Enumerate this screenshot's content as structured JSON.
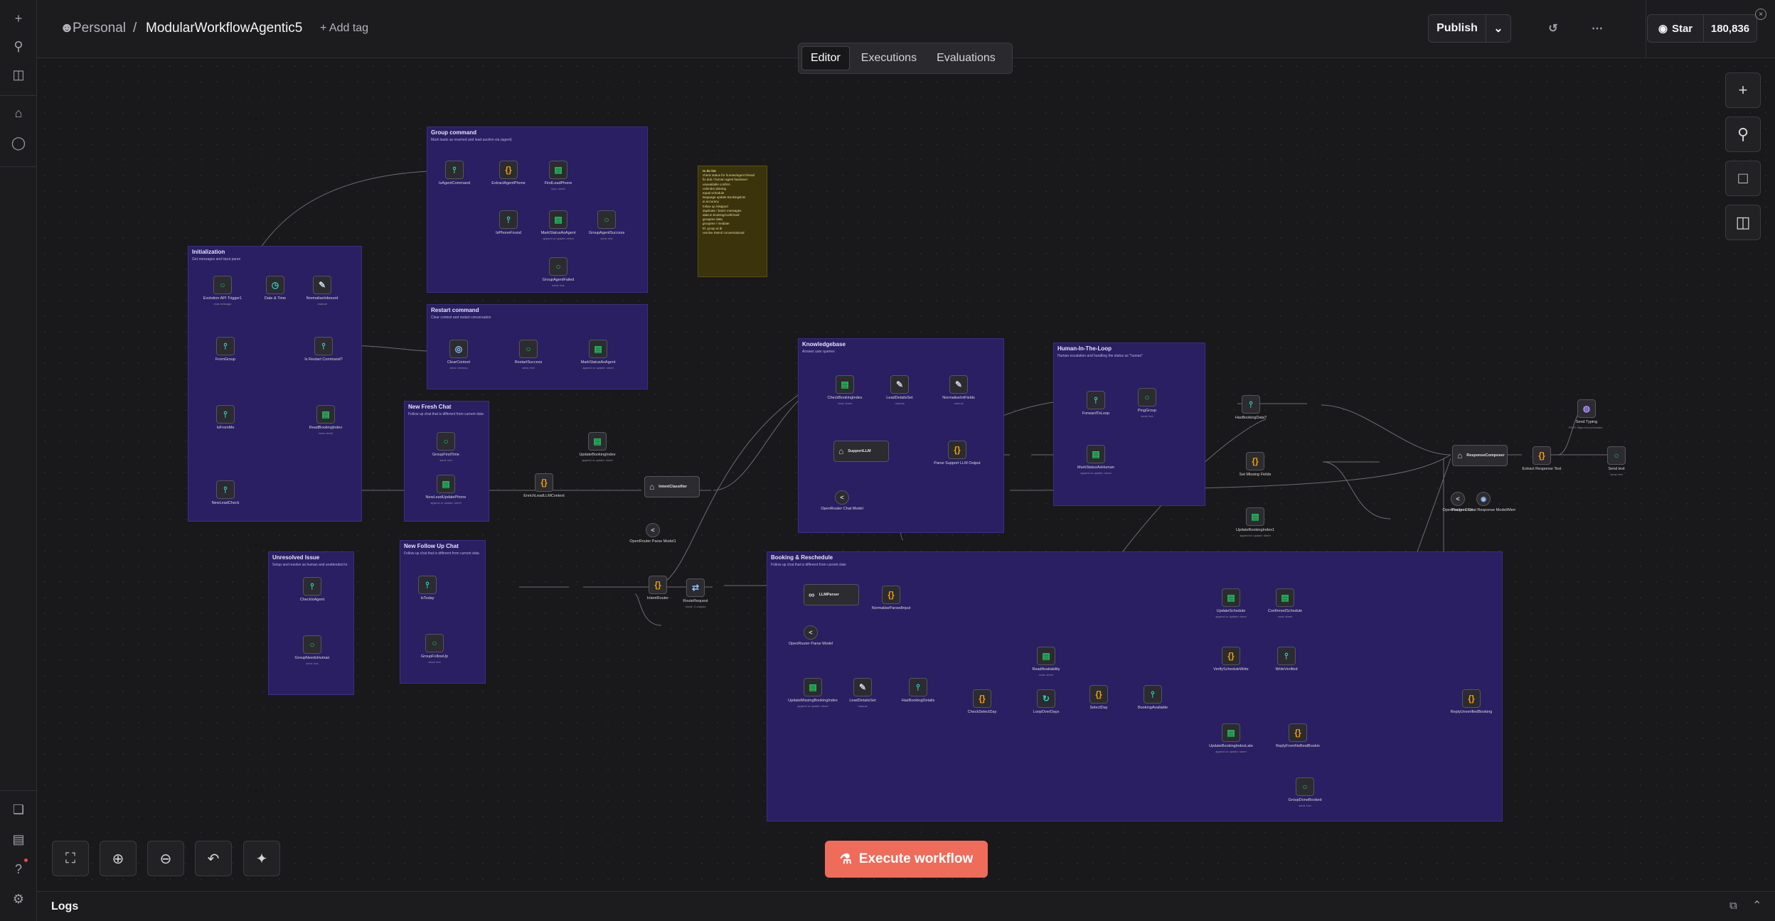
{
  "sidebar": {
    "top_icons": [
      "plus-icon",
      "search-icon",
      "panel-icon"
    ],
    "nav_icons": [
      "home-icon",
      "chat-icon"
    ],
    "bottom_icons": [
      "cube-icon",
      "chart-icon",
      "help-icon",
      "settings-icon"
    ]
  },
  "header": {
    "breadcrumb_owner": "Personal",
    "breadcrumb_sep": "/",
    "workflow_name": "ModularWorkflowAgentic5",
    "add_tag": "+ Add tag",
    "publish_label": "Publish",
    "star_label": "Star",
    "star_count": "180,836"
  },
  "tabs": [
    {
      "label": "Editor",
      "active": true
    },
    {
      "label": "Executions",
      "active": false
    },
    {
      "label": "Evaluations",
      "active": false
    }
  ],
  "execute_label": "Execute workflow",
  "logs_label": "Logs",
  "stickies": [
    {
      "title": "Initialization",
      "sub": "Get messages and input parse"
    },
    {
      "title": "Group command",
      "sub": "Mark leads as reached and lead auction via (agent)"
    },
    {
      "title": "Restart command",
      "sub": "Clear context and restart conversation"
    },
    {
      "title": "New Fresh Chat",
      "sub": "Follow up chat that is different from current data"
    },
    {
      "title": "Unresolved Issue",
      "sub": "Setup and resolve as human and unattended to"
    },
    {
      "title": "New Follow Up Chat",
      "sub": "Follow up chat that is different from current data"
    },
    {
      "title": "Knowledgebase",
      "sub": "Answer user queries"
    },
    {
      "title": "Human-In-The-Loop",
      "sub": "Human escalation and handling the status as \"human\""
    },
    {
      "title": "Booking & Reschedule",
      "sub": "Follow up chat that is different from current date"
    }
  ],
  "todo_note": {
    "title": "to do list",
    "items": [
      "check status for human/agent thread",
      "fix dob / human agent handover",
      "unavailable confirm",
      "calendar planing",
      "equal schedule",
      "language update Bookingslots",
      "ai accuracy",
      "follow up /skipped",
      "duplicate / batch messages",
      "data in booking/confirmed",
      "groupme data",
      "groupme / mediate",
      "bf. group ai tb",
      "resolve Intent/ conversational"
    ]
  },
  "nodes": [
    {
      "label": "Evolution API Trigger1",
      "sub": "chat.message",
      "icon": "chat-icon"
    },
    {
      "label": "Date & Time",
      "sub": "",
      "icon": "clock-icon"
    },
    {
      "label": "NormaliseInbound",
      "sub": "manual",
      "icon": "pen-icon"
    },
    {
      "label": "FromGroup",
      "sub": "",
      "icon": "filter-icon"
    },
    {
      "label": "Is Restart Command?",
      "sub": "",
      "icon": "filter-icon"
    },
    {
      "label": "IsFromMe",
      "sub": "",
      "icon": "filter-icon"
    },
    {
      "label": "ReadBookingIndex",
      "sub": "read: sheet",
      "icon": "sheet-icon"
    },
    {
      "label": "NewLeadCheck",
      "sub": "",
      "icon": "filter-icon"
    },
    {
      "label": "IsAgentCommand",
      "sub": "",
      "icon": "filter-icon"
    },
    {
      "label": "ExtractAgentPhone",
      "sub": "",
      "icon": "code-icon"
    },
    {
      "label": "FindLeadPhone",
      "sub": "lkup: sheet",
      "icon": "sheet-icon"
    },
    {
      "label": "IsPhoneFound",
      "sub": "",
      "icon": "filter-icon"
    },
    {
      "label": "MarkStatusAsAgent",
      "sub": "append or update: sheet",
      "icon": "sheet-icon"
    },
    {
      "label": "GroupAgentSuccess",
      "sub": "send: text",
      "icon": "chat-icon"
    },
    {
      "label": "GroupAgentFailed",
      "sub": "send: text",
      "icon": "chat-icon"
    },
    {
      "label": "ClearContext",
      "sub": "clear: memory",
      "icon": "memory-icon"
    },
    {
      "label": "RestartSuccess",
      "sub": "send: text",
      "icon": "chat-icon"
    },
    {
      "label": "MarkStatusAsAgent",
      "sub": "append or update: sheet",
      "icon": "sheet-icon"
    },
    {
      "label": "GroupFirstTime",
      "sub": "send: text",
      "icon": "chat-icon"
    },
    {
      "label": "NewLeadUpdatePhone",
      "sub": "append or update: sheet",
      "icon": "sheet-icon"
    },
    {
      "label": "EnrichLeadLLMContext",
      "sub": "",
      "icon": "code-icon"
    },
    {
      "label": "UpdateBookingIndex",
      "sub": "append or update: sheet",
      "icon": "sheet-icon"
    },
    {
      "label": "CheckIsAgent",
      "sub": "",
      "icon": "filter-icon"
    },
    {
      "label": "GroupNeedsHuman",
      "sub": "send: text",
      "icon": "chat-icon"
    },
    {
      "label": "IsToday",
      "sub": "",
      "icon": "filter-icon"
    },
    {
      "label": "GroupFollowUp",
      "sub": "send: text",
      "icon": "chat-icon"
    },
    {
      "label": "OpenRouter Parse Model1",
      "sub": "",
      "icon": "router-icon"
    },
    {
      "label": "IntentRouter",
      "sub": "",
      "icon": "code-icon"
    },
    {
      "label": "RouteRequest",
      "sub": "mode: 3 outputs",
      "icon": "switch-icon"
    },
    {
      "label": "CheckBookingIndex",
      "sub": "read: sheet",
      "icon": "sheet-icon"
    },
    {
      "label": "LeadDetailsSet",
      "sub": "manual",
      "icon": "pen-icon"
    },
    {
      "label": "NormaliseIntFields",
      "sub": "manual",
      "icon": "pen-icon"
    },
    {
      "label": "Parse Support LLM Output",
      "sub": "",
      "icon": "code-icon"
    },
    {
      "label": "OpenRouter Chat Model",
      "sub": "",
      "icon": "router-icon"
    },
    {
      "label": "ForwardToLoop",
      "sub": "",
      "icon": "filter-icon"
    },
    {
      "label": "PingGroup",
      "sub": "send: text",
      "icon": "chat-icon"
    },
    {
      "label": "MarkStatusAsHuman",
      "sub": "append or update: sheet",
      "icon": "sheet-icon"
    },
    {
      "label": "HasBookingData?",
      "sub": "",
      "icon": "filter-icon"
    },
    {
      "label": "Set Missing Fields",
      "sub": "",
      "icon": "code-icon"
    },
    {
      "label": "UpdateBookingIndex1",
      "sub": "append or update: sheet",
      "icon": "sheet-icon"
    },
    {
      "label": "Extract Response Text",
      "sub": "",
      "icon": "code-icon"
    },
    {
      "label": "Send Typing",
      "sub": "POST https://evo.evolution...",
      "icon": "globe-icon"
    },
    {
      "label": "Send text",
      "sub": "send: text",
      "icon": "chat-icon"
    },
    {
      "label": "OpenRouter Chat",
      "sub": "",
      "icon": "router-icon"
    },
    {
      "label": "Postgres Chat Response Model/Memory1",
      "sub": "",
      "icon": "db-icon"
    },
    {
      "label": "NormaliseParsedInput",
      "sub": "",
      "icon": "code-icon"
    },
    {
      "label": "OpenRouter Parse Model",
      "sub": "",
      "icon": "router-icon"
    },
    {
      "label": "UpdateMissingBookingIndex",
      "sub": "append or update: sheet",
      "icon": "sheet-icon"
    },
    {
      "label": "LeadDetailsSet",
      "sub": "manual",
      "icon": "pen-icon"
    },
    {
      "label": "HasBookingDetails",
      "sub": "",
      "icon": "filter-icon"
    },
    {
      "label": "CheckSelectDay",
      "sub": "",
      "icon": "code-icon"
    },
    {
      "label": "ReadAvailability",
      "sub": "read: sheet",
      "icon": "sheet-icon"
    },
    {
      "label": "LoopOverDays",
      "sub": "",
      "icon": "loop-icon"
    },
    {
      "label": "SelectDay",
      "sub": "",
      "icon": "code-icon"
    },
    {
      "label": "BookingAvailable",
      "sub": "",
      "icon": "filter-icon"
    },
    {
      "label": "UpdateSchedule",
      "sub": "append or update: sheet",
      "icon": "sheet-icon"
    },
    {
      "label": "ConfirmedSchedule",
      "sub": "read: sheet",
      "icon": "sheet-icon"
    },
    {
      "label": "VerifyScheduleWrite",
      "sub": "",
      "icon": "code-icon"
    },
    {
      "label": "WriteVerified",
      "sub": "",
      "icon": "filter-icon"
    },
    {
      "label": "UpdateBookingIndexLate",
      "sub": "append or update: sheet",
      "icon": "sheet-icon"
    },
    {
      "label": "ReplyFromNoBestBookin",
      "sub": "",
      "icon": "code-icon"
    },
    {
      "label": "GroupDoneBooked",
      "sub": "send: text",
      "icon": "chat-icon"
    },
    {
      "label": "ReplyUnverifiedBooking",
      "sub": "",
      "icon": "code-icon"
    }
  ],
  "wide_nodes": [
    {
      "label": "IntentClassifier",
      "icon": "robot-icon"
    },
    {
      "label": "SupportLLM",
      "icon": "robot-icon"
    },
    {
      "label": "LLMParser",
      "icon": "link-icon"
    },
    {
      "label": "ResponseComposer",
      "icon": "robot-icon"
    }
  ],
  "colors": {
    "accent": "#ef6b5a",
    "sticky_bg": "#2a1f63",
    "node_green": "#22c55e",
    "node_orange": "#f59e0b",
    "canvas_bg": "#19191b"
  }
}
